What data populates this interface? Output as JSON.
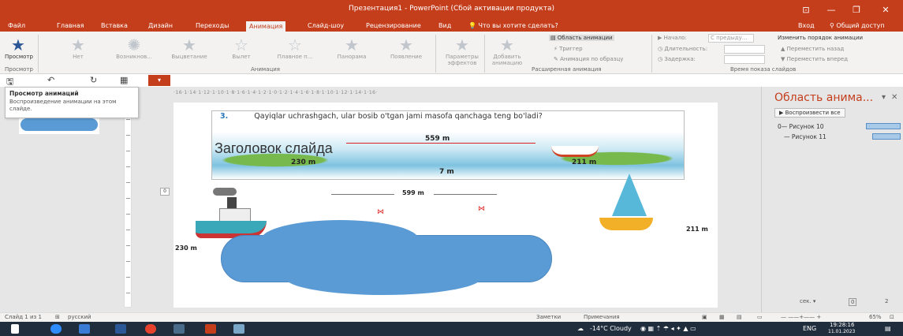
{
  "window": {
    "title": "Презентация1 - PowerPoint (Сбой активации продукта)",
    "controls": [
      "⊡",
      "—",
      "❐",
      "✕"
    ]
  },
  "tabs": [
    "Файл",
    "Главная",
    "Вставка",
    "Дизайн",
    "Переходы",
    "Анимация",
    "Слайд-шоу",
    "Рецензирование",
    "Вид",
    "Что вы хотите сделать?"
  ],
  "account": {
    "login": "Вход",
    "share": "Общий доступ"
  },
  "ribbon": {
    "preview_group": {
      "button": "Просмотр",
      "label": "Просмотр"
    },
    "animation_group": {
      "items": [
        "Нет",
        "Возникнов...",
        "Выцветание",
        "Вылет",
        "Плавное п...",
        "Панорама",
        "Появление"
      ],
      "label": "Анимация",
      "effect_params": "Параметры эффектов"
    },
    "advanced_group": {
      "add_animation": "Добавить анимацию",
      "animation_pane": "Область анимации",
      "trigger": "Триггер",
      "painter": "Анимация по образцу",
      "label": "Расширенная анимация"
    },
    "timing_group": {
      "start_label": "Начало:",
      "start_value": "С предыду...",
      "duration_label": "Длительность:",
      "delay_label": "Задержка:",
      "label": "Время показа слайдов"
    },
    "reorder_group": {
      "title": "Изменить порядок анимации",
      "move_back": "Переместить назад",
      "move_forward": "Переместить вперед"
    }
  },
  "tooltip": {
    "title": "Просмотр анимаций",
    "description": "Воспроизведение анимации на этом слайде."
  },
  "ruler_text": "·16·1·14·1·12·1·10·1·8·1·6·1·4·1·2·1·0·1·2·1·4·1·6·1·8·1·10·1·12·1·14·1·16·",
  "slide": {
    "question_number": "3.",
    "question_text": "Qayiqlar uchrashgach, ular bosib o'tgan jami masofa qanchaga teng bo'ladi?",
    "pic_dist_top": "559 m",
    "pic_dist_left": "230 m",
    "pic_dist_mid": "7 m",
    "pic_dist_right": "211 m",
    "title_placeholder": "Заголовок слайда",
    "dist_total": "599 m",
    "dist_left": "230 m",
    "dist_right": "211 m",
    "ruler_zero": "0"
  },
  "animation_pane": {
    "title": "Область анима...",
    "play_button": "Воспроизвести все",
    "items": [
      {
        "prefix": "0—",
        "label": "Рисунок 10"
      },
      {
        "prefix": "—",
        "label": "Рисунок 11"
      }
    ],
    "footer_seconds": "сек.",
    "footer_zoom_start": "0",
    "footer_zoom_end": "2"
  },
  "statusbar": {
    "slide_info": "Слайд 1 из 1",
    "language": "русский",
    "notes": "Заметки",
    "comments": "Примечания",
    "zoom": "65%"
  },
  "taskbar": {
    "weather": "-14°C Cloudy",
    "lang": "ENG",
    "time": "19:28:16",
    "date": "11.01.2023"
  },
  "colors": {
    "accent": "#c43e1c",
    "cloud": "#5b9bd5",
    "taskbar": "#1f2d3d"
  }
}
